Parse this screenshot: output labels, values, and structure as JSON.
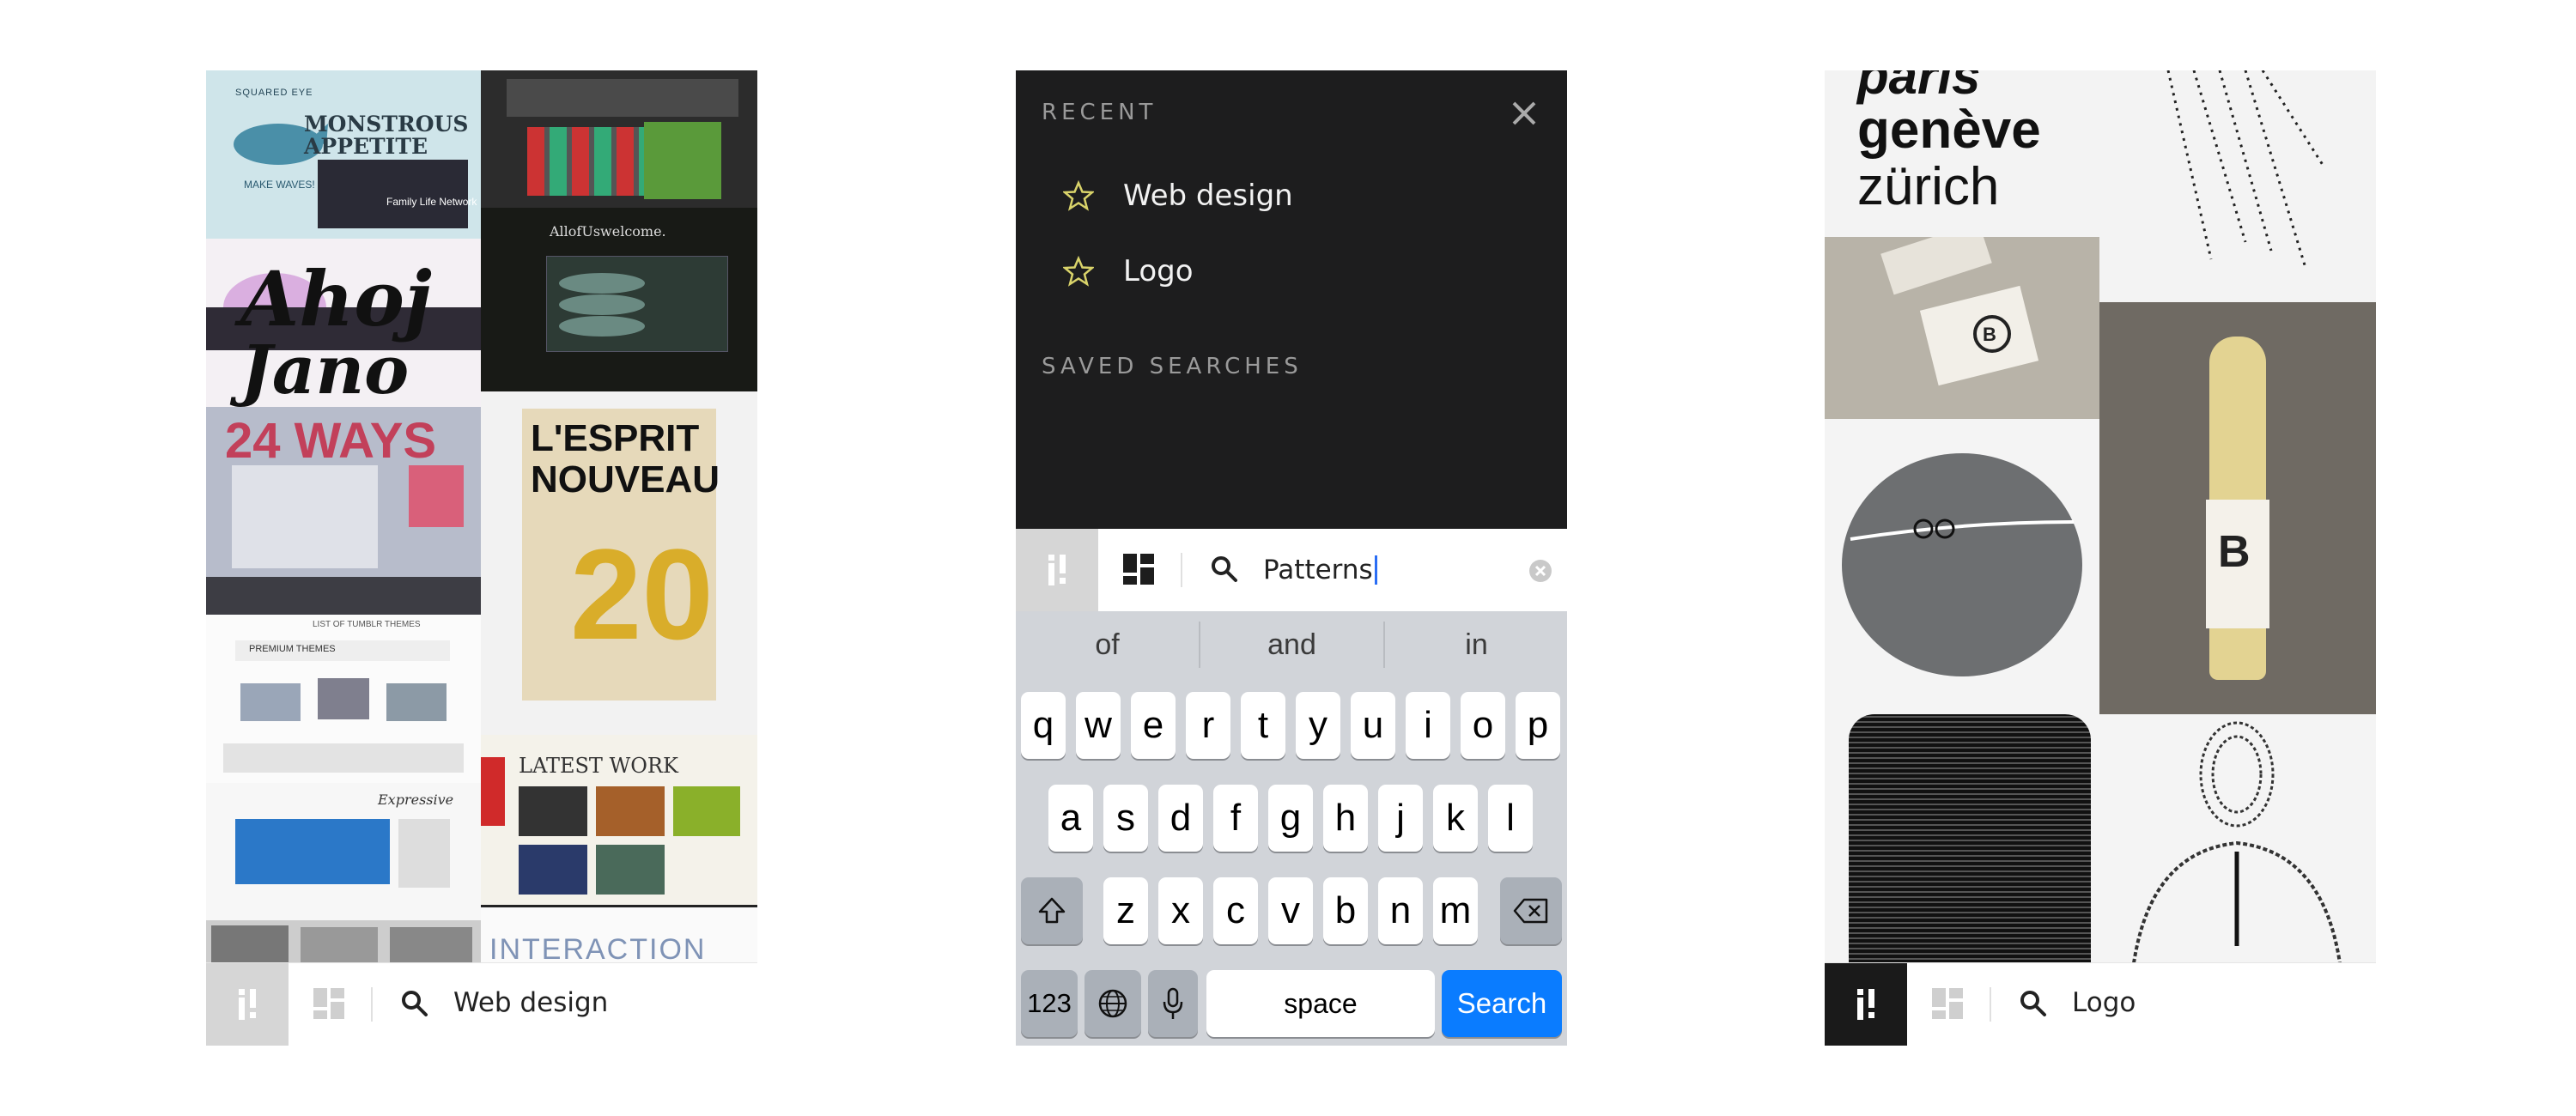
{
  "screens": {
    "left": {
      "tiles": {
        "squared_eye": "SQUARED EYE",
        "monstrous": "MONSTROUS",
        "appetite": "APPETITE",
        "make_waves": "MAKE WAVES!",
        "family_life": "Family Life Network",
        "ahoj": "Ahoj",
        "jano": "Jano",
        "ways_24": "24 WAYS",
        "all_of_us": "AllofUswelcome.",
        "lesprit": "L'ESPRIT",
        "nouveau": "NOUVEAU",
        "no20": "20",
        "tumblr_title": "LIST OF TUMBLR THEMES",
        "premium_themes": "PREMIUM THEMES",
        "latest_work": "LATEST WORK",
        "interaction": "INTERACTION",
        "expressive": "Expressive"
      },
      "bar": {
        "query": "Web design"
      }
    },
    "middle": {
      "recent_title": "RECENT",
      "recent": [
        {
          "label": "Web design"
        },
        {
          "label": "Logo"
        }
      ],
      "saved_title": "SAVED SEARCHES",
      "search": {
        "value": "Patterns"
      },
      "suggestions": [
        "of",
        "and",
        "in"
      ],
      "keyboard": {
        "row1": [
          "q",
          "w",
          "e",
          "r",
          "t",
          "y",
          "u",
          "i",
          "o",
          "p"
        ],
        "row2": [
          "a",
          "s",
          "d",
          "f",
          "g",
          "h",
          "j",
          "k",
          "l"
        ],
        "row3": [
          "z",
          "x",
          "c",
          "v",
          "b",
          "n",
          "m"
        ],
        "numbers": "123",
        "space": "space",
        "search": "Search"
      }
    },
    "right": {
      "tiles": {
        "paris": "paris",
        "geneve": "genève",
        "zurich": "zürich"
      },
      "bar": {
        "query": "Logo"
      }
    }
  },
  "colors": {
    "accent_blue": "#0a7cff",
    "star_yellow": "#d9d36a",
    "dark_bg": "#1d1d1e"
  }
}
